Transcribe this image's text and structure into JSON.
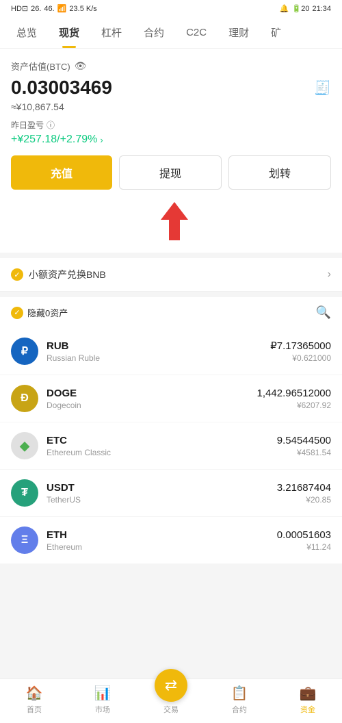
{
  "statusBar": {
    "left": "HD⊡ 26. 46.",
    "network": "23.5 K/s",
    "time": "21:34"
  },
  "navTabs": [
    {
      "id": "overview",
      "label": "总览"
    },
    {
      "id": "spot",
      "label": "现货",
      "active": true
    },
    {
      "id": "leverage",
      "label": "杠杆"
    },
    {
      "id": "contract",
      "label": "合约"
    },
    {
      "id": "c2c",
      "label": "C2C"
    },
    {
      "id": "finance",
      "label": "理财"
    },
    {
      "id": "mining",
      "label": "矿"
    }
  ],
  "asset": {
    "label": "资产估值(BTC)",
    "btcValue": "0.03003469",
    "cnyApprox": "≈¥10,867.54",
    "profitLabel": "昨日盈亏",
    "profitValue": "+¥257.18/+2.79%"
  },
  "buttons": {
    "recharge": "充值",
    "withdraw": "提现",
    "transfer": "划转"
  },
  "bnbBanner": {
    "text": "小额资产兑换BNB"
  },
  "assetListHeader": {
    "hideLabel": "隐藏0资产"
  },
  "coins": [
    {
      "symbol": "RUB",
      "name": "Russian Ruble",
      "amount": "₽7.17365000",
      "cny": "¥0.621000",
      "bgColor": "#1565c0",
      "textColor": "#fff",
      "iconText": "₽"
    },
    {
      "symbol": "DOGE",
      "name": "Dogecoin",
      "amount": "1,442.96512000",
      "cny": "¥6207.92",
      "bgColor": "#c8a415",
      "textColor": "#fff",
      "iconText": "Ð"
    },
    {
      "symbol": "ETC",
      "name": "Ethereum Classic",
      "amount": "9.54544500",
      "cny": "¥4581.54",
      "bgColor": "#e0e0e0",
      "textColor": "#4caf50",
      "iconText": "◆"
    },
    {
      "symbol": "USDT",
      "name": "TetherUS",
      "amount": "3.21687404",
      "cny": "¥20.85",
      "bgColor": "#26a17b",
      "textColor": "#fff",
      "iconText": "₮"
    },
    {
      "symbol": "ETH",
      "name": "Ethereum",
      "amount": "0.00051603",
      "cny": "¥11.24",
      "bgColor": "#627eea",
      "textColor": "#fff",
      "iconText": "Ξ"
    }
  ],
  "bottomNav": [
    {
      "id": "home",
      "label": "首页",
      "icon": "🏠",
      "active": false
    },
    {
      "id": "market",
      "label": "市场",
      "icon": "📊",
      "active": false
    },
    {
      "id": "trade",
      "label": "交易",
      "icon": "🔄",
      "active": false
    },
    {
      "id": "futures",
      "label": "合约",
      "icon": "📋",
      "active": false
    },
    {
      "id": "assets",
      "label": "资金",
      "icon": "💼",
      "active": true
    }
  ]
}
